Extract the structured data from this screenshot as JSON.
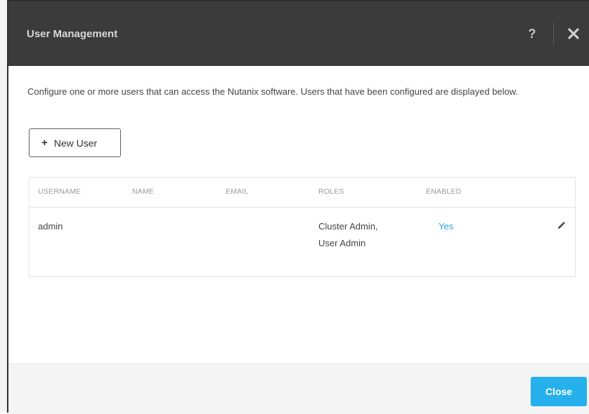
{
  "dialog": {
    "title": "User Management",
    "help_label": "?",
    "close_icon": "close-icon",
    "description": "Configure one or more users that can access the Nutanix software. Users that have been configured are displayed below.",
    "new_user_button": {
      "icon": "+",
      "label": "New User"
    },
    "table": {
      "columns": [
        "USERNAME",
        "NAME",
        "EMAIL",
        "ROLES",
        "ENABLED"
      ],
      "rows": [
        {
          "username": "admin",
          "name": "",
          "email": "",
          "roles_line1": "Cluster Admin,",
          "roles_line2": "User Admin",
          "enabled": "Yes",
          "edit_icon": "pencil-icon"
        }
      ]
    },
    "footer": {
      "close_label": "Close"
    }
  },
  "colors": {
    "header_bg": "#3b3b3b",
    "accent": "#26b1ec",
    "link": "#2aa3e0"
  }
}
